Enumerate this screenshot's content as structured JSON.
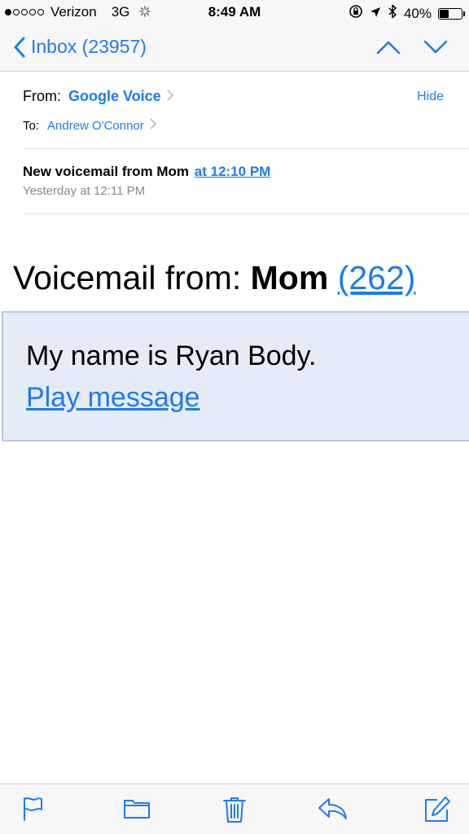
{
  "status_bar": {
    "carrier": "Verizon",
    "network": "3G",
    "time": "8:49 AM",
    "battery": "40%",
    "battery_level": 0.4,
    "signal_bars": 1,
    "icons": [
      "activity-spinner-icon",
      "rotation-lock-icon",
      "location-arrow-icon",
      "bluetooth-icon",
      "battery-icon"
    ]
  },
  "nav": {
    "back_label": "Inbox (23957)",
    "icons": [
      "chevron-left-icon",
      "previous-message-icon",
      "next-message-icon"
    ]
  },
  "header": {
    "from_label": "From:",
    "from_value": "Google Voice",
    "hide_label": "Hide",
    "to_label": "To:",
    "to_value": "Andrew O'Connor",
    "subject_text": "New voicemail from Mom",
    "subject_link": "at 12:10 PM",
    "date": "Yesterday at 12:11 PM"
  },
  "body": {
    "title_prefix": "Voicemail from: ",
    "title_name": "Mom",
    "title_link": "(262)",
    "message": "My name is Ryan Body.",
    "play_label": "Play message"
  },
  "toolbar": {
    "icons": [
      "flag-icon",
      "folder-icon",
      "trash-icon",
      "reply-icon",
      "compose-icon"
    ]
  },
  "colors": {
    "accent": "#1b7cf0",
    "message_box_bg": "#e6ecf7",
    "message_box_border": "#b9c7e6",
    "bar_bg": "#f7f7f7"
  }
}
